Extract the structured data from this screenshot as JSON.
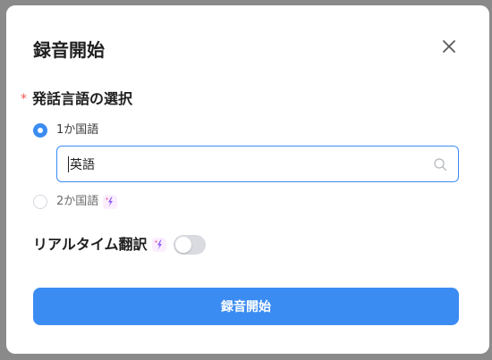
{
  "dialog": {
    "title": "録音開始",
    "close_icon": "close-icon"
  },
  "language_section": {
    "required_mark": "*",
    "label": "発話言語の選択",
    "options": [
      {
        "label": "1か国語",
        "selected": true
      },
      {
        "label": "2か国語",
        "selected": false,
        "badge_icon": "sparkle-icon"
      }
    ],
    "search": {
      "value": "英語",
      "icon": "search-icon"
    }
  },
  "realtime_translation": {
    "label": "リアルタイム翻訳",
    "badge_icon": "sparkle-icon",
    "enabled": false
  },
  "start_button": {
    "label": "録音開始"
  },
  "colors": {
    "accent": "#3b8cf2",
    "required": "#f25555",
    "sparkle_bg": "#fbeefe"
  }
}
